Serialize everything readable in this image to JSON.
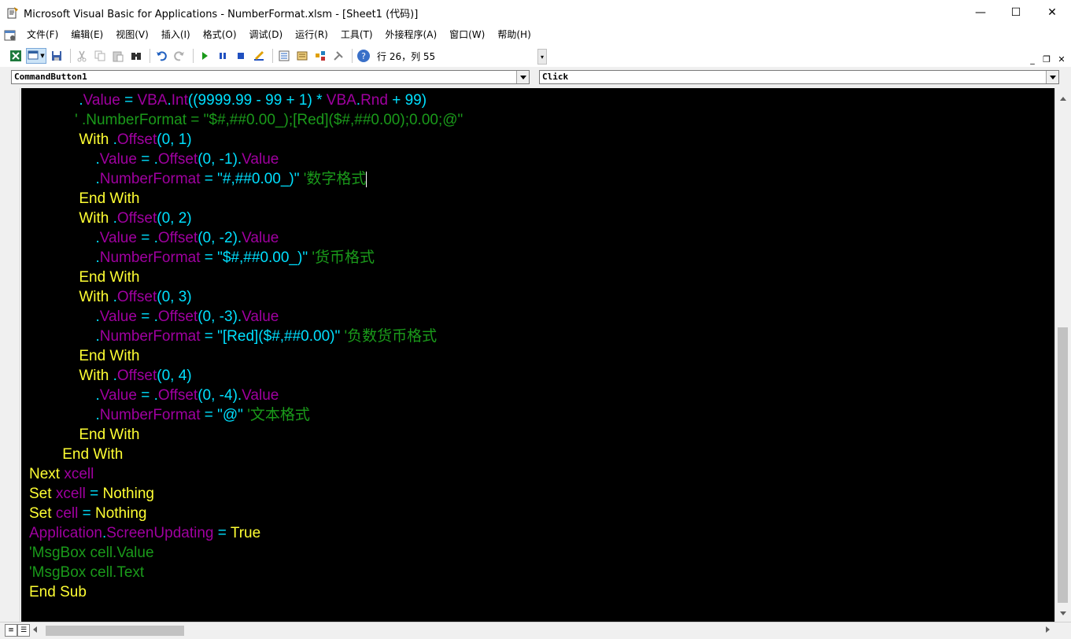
{
  "window": {
    "title": "Microsoft Visual Basic for Applications - NumberFormat.xlsm - [Sheet1 (代码)]",
    "minimize": "—",
    "maximize": "☐",
    "close": "✕"
  },
  "menu": {
    "items": [
      "文件(F)",
      "编辑(E)",
      "视图(V)",
      "插入(I)",
      "格式(O)",
      "调试(D)",
      "运行(R)",
      "工具(T)",
      "外接程序(A)",
      "窗口(W)",
      "帮助(H)"
    ],
    "mdi_minimize": "_",
    "mdi_restore": "❐",
    "mdi_close": "✕"
  },
  "toolbar": {
    "status": "行 26，列 55",
    "icons": [
      "excel-icon",
      "insert-userform-icon",
      "save-icon",
      "cut-icon",
      "copy-icon",
      "paste-icon",
      "find-icon",
      "undo-icon",
      "redo-icon",
      "run-icon",
      "break-icon",
      "reset-icon",
      "design-mode-icon",
      "project-explorer-icon",
      "properties-icon",
      "object-browser-icon",
      "toolbox-icon",
      "help-icon"
    ]
  },
  "combos": {
    "object": "CommandButton1",
    "procedure": "Click"
  },
  "colors": {
    "background": "#000000",
    "keyword": "#ffff33",
    "identifier": "#a000a0",
    "operator": "#00e0ff",
    "comment": "#1a9a1a"
  },
  "code": {
    "lines": [
      [
        {
          "c": "op",
          "t": "            ."
        },
        {
          "c": "id",
          "t": "Value"
        },
        {
          "c": "op",
          "t": " = "
        },
        {
          "c": "id",
          "t": "VBA"
        },
        {
          "c": "op",
          "t": "."
        },
        {
          "c": "id",
          "t": "Int"
        },
        {
          "c": "op",
          "t": "((9999.99 - 99 + 1) * "
        },
        {
          "c": "id",
          "t": "VBA"
        },
        {
          "c": "op",
          "t": "."
        },
        {
          "c": "id",
          "t": "Rnd"
        },
        {
          "c": "op",
          "t": " + 99)"
        }
      ],
      [
        {
          "c": "cm",
          "t": "           ' .NumberFormat = \"$#,##0.00_);[Red]($#,##0.00);0.00;@\""
        }
      ],
      [
        {
          "c": "kw",
          "t": "            With "
        },
        {
          "c": "op",
          "t": "."
        },
        {
          "c": "id",
          "t": "Offset"
        },
        {
          "c": "op",
          "t": "(0, 1)"
        }
      ],
      [
        {
          "c": "op",
          "t": "                ."
        },
        {
          "c": "id",
          "t": "Value"
        },
        {
          "c": "op",
          "t": " = ."
        },
        {
          "c": "id",
          "t": "Offset"
        },
        {
          "c": "op",
          "t": "(0, -1)."
        },
        {
          "c": "id",
          "t": "Value"
        }
      ],
      [
        {
          "c": "op",
          "t": "                ."
        },
        {
          "c": "id",
          "t": "NumberFormat"
        },
        {
          "c": "op",
          "t": " = \"#,##0.00_)\" "
        },
        {
          "c": "cm",
          "t": "'数字格式"
        },
        {
          "c": "cursor",
          "t": ""
        }
      ],
      [
        {
          "c": "kw",
          "t": "            End With"
        }
      ],
      [
        {
          "c": "kw",
          "t": "            With "
        },
        {
          "c": "op",
          "t": "."
        },
        {
          "c": "id",
          "t": "Offset"
        },
        {
          "c": "op",
          "t": "(0, 2)"
        }
      ],
      [
        {
          "c": "op",
          "t": "                ."
        },
        {
          "c": "id",
          "t": "Value"
        },
        {
          "c": "op",
          "t": " = ."
        },
        {
          "c": "id",
          "t": "Offset"
        },
        {
          "c": "op",
          "t": "(0, -2)."
        },
        {
          "c": "id",
          "t": "Value"
        }
      ],
      [
        {
          "c": "op",
          "t": "                ."
        },
        {
          "c": "id",
          "t": "NumberFormat"
        },
        {
          "c": "op",
          "t": " = \"$#,##0.00_)\" "
        },
        {
          "c": "cm",
          "t": "'货币格式"
        }
      ],
      [
        {
          "c": "kw",
          "t": "            End With"
        }
      ],
      [
        {
          "c": "kw",
          "t": "            With "
        },
        {
          "c": "op",
          "t": "."
        },
        {
          "c": "id",
          "t": "Offset"
        },
        {
          "c": "op",
          "t": "(0, 3)"
        }
      ],
      [
        {
          "c": "op",
          "t": "                ."
        },
        {
          "c": "id",
          "t": "Value"
        },
        {
          "c": "op",
          "t": " = ."
        },
        {
          "c": "id",
          "t": "Offset"
        },
        {
          "c": "op",
          "t": "(0, -3)."
        },
        {
          "c": "id",
          "t": "Value"
        }
      ],
      [
        {
          "c": "op",
          "t": "                ."
        },
        {
          "c": "id",
          "t": "NumberFormat"
        },
        {
          "c": "op",
          "t": " = \"[Red]($#,##0.00)\" "
        },
        {
          "c": "cm",
          "t": "'负数货币格式"
        }
      ],
      [
        {
          "c": "kw",
          "t": "            End With"
        }
      ],
      [
        {
          "c": "kw",
          "t": "            With "
        },
        {
          "c": "op",
          "t": "."
        },
        {
          "c": "id",
          "t": "Offset"
        },
        {
          "c": "op",
          "t": "(0, 4)"
        }
      ],
      [
        {
          "c": "op",
          "t": "                ."
        },
        {
          "c": "id",
          "t": "Value"
        },
        {
          "c": "op",
          "t": " = ."
        },
        {
          "c": "id",
          "t": "Offset"
        },
        {
          "c": "op",
          "t": "(0, -4)."
        },
        {
          "c": "id",
          "t": "Value"
        }
      ],
      [
        {
          "c": "op",
          "t": "                ."
        },
        {
          "c": "id",
          "t": "NumberFormat"
        },
        {
          "c": "op",
          "t": " = \"@\" "
        },
        {
          "c": "cm",
          "t": "'文本格式"
        }
      ],
      [
        {
          "c": "kw",
          "t": "            End With"
        }
      ],
      [
        {
          "c": "kw",
          "t": "        End With"
        }
      ],
      [
        {
          "c": "kw",
          "t": "Next "
        },
        {
          "c": "id",
          "t": "xcell"
        }
      ],
      [
        {
          "c": "kw",
          "t": "Set "
        },
        {
          "c": "id",
          "t": "xcell"
        },
        {
          "c": "op",
          "t": " = "
        },
        {
          "c": "kw",
          "t": "Nothing"
        }
      ],
      [
        {
          "c": "kw",
          "t": "Set "
        },
        {
          "c": "id",
          "t": "cell"
        },
        {
          "c": "op",
          "t": " = "
        },
        {
          "c": "kw",
          "t": "Nothing"
        }
      ],
      [
        {
          "c": "id",
          "t": "Application"
        },
        {
          "c": "op",
          "t": "."
        },
        {
          "c": "id",
          "t": "ScreenUpdating"
        },
        {
          "c": "op",
          "t": " = "
        },
        {
          "c": "kw",
          "t": "True"
        }
      ],
      [
        {
          "c": "cm",
          "t": "'MsgBox cell.Value"
        }
      ],
      [
        {
          "c": "cm",
          "t": "'MsgBox cell.Text"
        }
      ],
      [
        {
          "c": "kw",
          "t": "End Sub"
        }
      ]
    ]
  }
}
